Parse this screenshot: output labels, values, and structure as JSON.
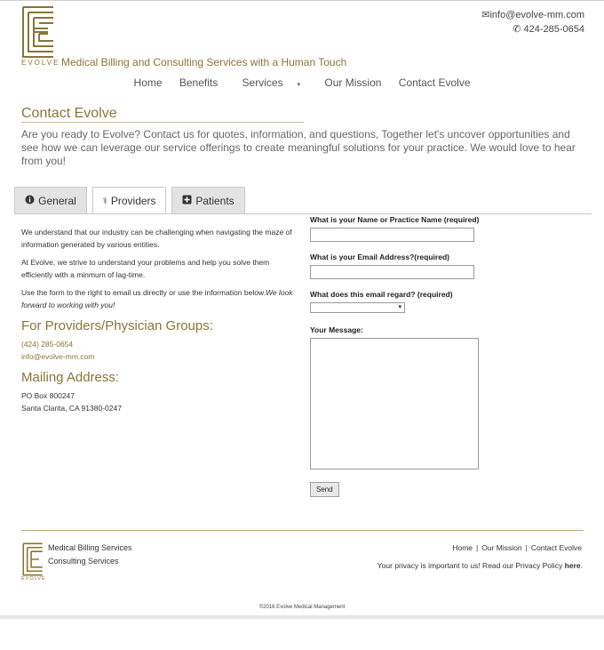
{
  "brand": {
    "logo_word": "EVOLVE",
    "tagline": "Medical Billing and Consulting Services with a Human Touch",
    "color": "#8a7437"
  },
  "header_contact": {
    "email": "info@evolve-mm.com",
    "phone": "424-285-0654"
  },
  "nav": {
    "items": [
      "Home",
      "Benefits",
      "Services",
      "Our Mission",
      "Contact Evolve"
    ]
  },
  "page": {
    "title": "Contact Evolve",
    "intro": "Are you ready to Evolve? Contact us for quotes, information, and questions, Together let's uncover opportunities and see how we can leverage our service offerings to create meaningful solutions for your practice. We would love to hear from you!"
  },
  "tabs": [
    {
      "label": "General",
      "icon": "info-circle-icon"
    },
    {
      "label": "Providers",
      "icon": "stethoscope-icon",
      "active": true
    },
    {
      "label": "Patients",
      "icon": "plus-square-icon"
    }
  ],
  "providers": {
    "p1": "We understand that our industry can be challenging when navigating the maze of information generated by various entities.",
    "p2": "At Evolve, we strive to understand your problems and help you solve them efficiently with a minmum of lag-time.",
    "p3": "Use the form to the right to email us directly or use the information below.",
    "p3_em": "We look forward to working with you!",
    "heading": "For Providers/Physician Groups:",
    "phone": "(424) 285-0654",
    "email": "info@evolve-mm.com",
    "mailing_heading": "Mailing Address:",
    "address1": "PO Box 800247",
    "address2": "Santa Clarita, CA 91380-0247"
  },
  "form": {
    "name_label": "What is your Name or Practice Name (required)",
    "email_label": "What is your Email Address?(required)",
    "regard_label": "What does this email regard? (required)",
    "message_label": "Your Message:",
    "send_label": "Send"
  },
  "footer": {
    "services1": "Medical Billing Services",
    "services2": "Consulting Services",
    "links": [
      "Home",
      "Our Mission",
      "Contact Evolve"
    ],
    "privacy_text": "Your privacy is important to us! Read our Privacy Policy ",
    "privacy_link": "here",
    "privacy_end": ".",
    "copyright": "©2016 Evolve Medical Management"
  }
}
